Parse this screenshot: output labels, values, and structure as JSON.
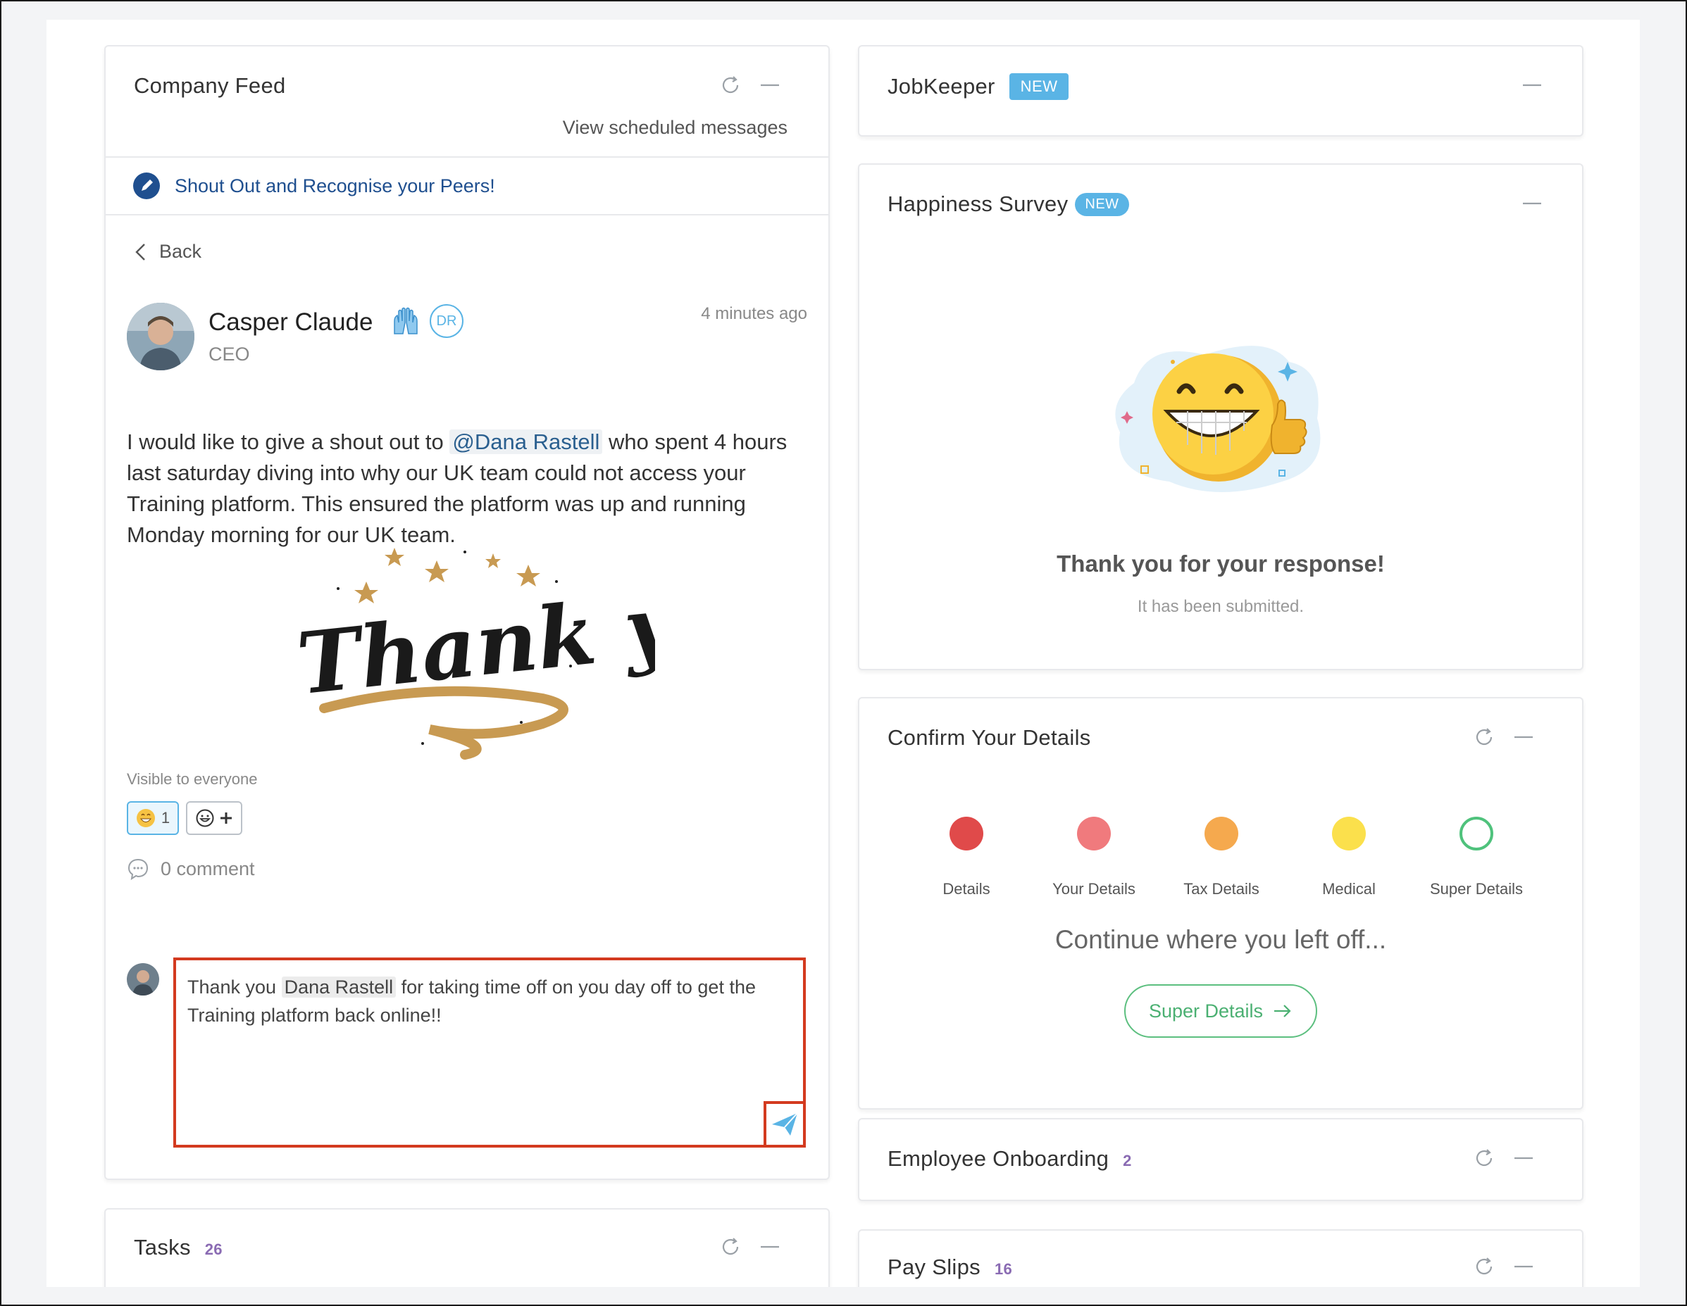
{
  "feed": {
    "title": "Company Feed",
    "view_scheduled": "View scheduled messages",
    "shoutout_label": "Shout Out and Recognise your Peers!",
    "back_label": "Back",
    "post": {
      "author": "Casper Claude",
      "role": "CEO",
      "initials": "DR",
      "time": "4 minutes ago",
      "text_before": "I would like to give a shout out to ",
      "mention": "@Dana Rastell",
      "text_after": " who spent 4 hours last saturday diving into why our UK team could not access your Training platform. This ensured the platform was up and running Monday morning for our UK team.",
      "visibility": "Visible to everyone",
      "reaction_count": "1",
      "comment_count": "0 comment"
    },
    "comment": {
      "text_before": "Thank you ",
      "mention": "Dana Rastell",
      "text_after": " for taking time off on you day off to get the Training platform back online!!"
    }
  },
  "tasks": {
    "title": "Tasks",
    "count": "26"
  },
  "jobkeeper": {
    "title": "JobKeeper",
    "badge": "NEW"
  },
  "happiness": {
    "title": "Happiness Survey",
    "badge": "NEW",
    "thanks": "Thank you for your response!",
    "submitted": "It has been submitted."
  },
  "confirm": {
    "title": "Confirm Your Details",
    "steps": [
      {
        "label": "Details",
        "color": "#e04a4a"
      },
      {
        "label": "Your Details",
        "color": "#f07a7d"
      },
      {
        "label": "Tax Details",
        "color": "#f5a94e"
      },
      {
        "label": "Medical",
        "color": "#fbe04c"
      },
      {
        "label": "Super Details",
        "color": "#4fc27c"
      }
    ],
    "continue_text": "Continue where you left off...",
    "button_label": "Super Details"
  },
  "onboarding": {
    "title": "Employee Onboarding",
    "count": "2"
  },
  "payslips": {
    "title": "Pay Slips",
    "count": "16"
  },
  "colors": {
    "accent": "#5ab4e5",
    "count": "#8a6bb3",
    "highlight_border": "#d33a1f",
    "success": "#4fc27c"
  }
}
